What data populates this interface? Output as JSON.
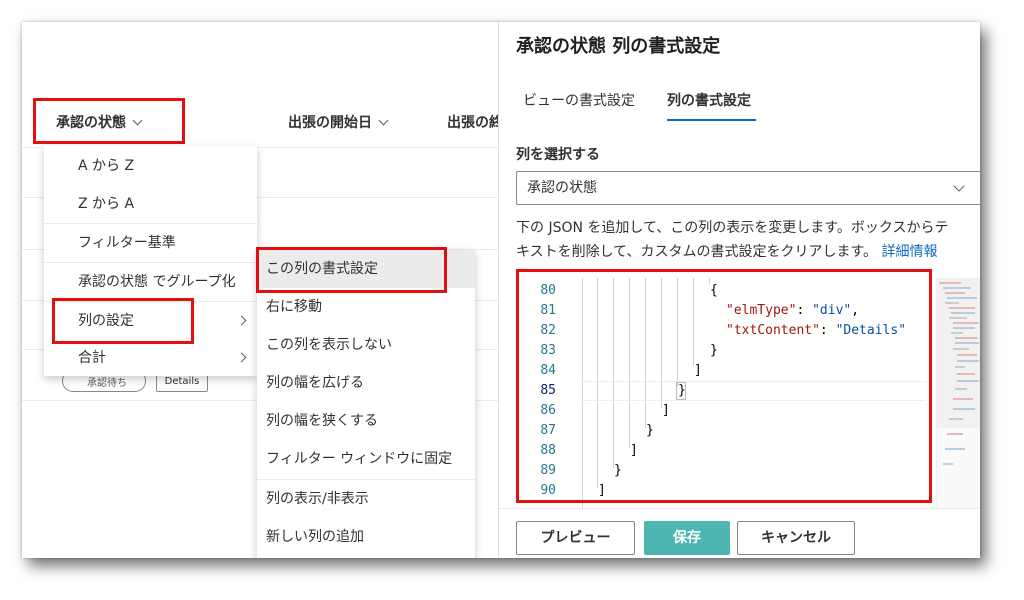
{
  "list": {
    "columns": [
      {
        "label": "承認の状態"
      },
      {
        "label": "出張の開始日"
      },
      {
        "label": "出張の終"
      }
    ],
    "row": {
      "status_label": "承認待ち",
      "details_label": "Details"
    }
  },
  "context_menu": {
    "items": [
      {
        "label": "A から Z"
      },
      {
        "label": "Z から A"
      },
      {
        "label": "フィルター基準"
      },
      {
        "label": "承認の状態 でグループ化"
      },
      {
        "label": "列の設定"
      },
      {
        "label": "合計"
      }
    ]
  },
  "submenu": {
    "items": [
      {
        "label": "この列の書式設定"
      },
      {
        "label": "右に移動"
      },
      {
        "label": "この列を表示しない"
      },
      {
        "label": "列の幅を広げる"
      },
      {
        "label": "列の幅を狭くする"
      },
      {
        "label": "フィルター ウィンドウに固定"
      },
      {
        "label": "列の表示/非表示"
      },
      {
        "label": "新しい列の追加"
      }
    ]
  },
  "panel": {
    "title": "承認の状態 列の書式設定",
    "tabs": [
      {
        "label": "ビューの書式設定"
      },
      {
        "label": "列の書式設定"
      }
    ],
    "select_label": "列を選択する",
    "selected_column": "承認の状態",
    "description_line1": "下の JSON を追加して、この列の表示を変更します。ボックスからテ",
    "description_line2": "キストを削除して、カスタムの書式設定をクリアします。",
    "learn_more": "詳細情報",
    "editor": {
      "line_numbers": [
        "80",
        "81",
        "82",
        "83",
        "84",
        "85",
        "86",
        "87",
        "88",
        "89",
        "90"
      ],
      "current_line": "85",
      "lines": [
        {
          "text": "{"
        },
        {
          "key": "\"elmType\"",
          "sep": ": ",
          "value": "\"div\"",
          "end": ","
        },
        {
          "key": "\"txtContent\"",
          "sep": ": ",
          "value": "\"Details\"",
          "end": ""
        },
        {
          "text": "}"
        },
        {
          "text": "]"
        },
        {
          "text": "}"
        },
        {
          "text": "]"
        },
        {
          "text": "}"
        },
        {
          "text": "]"
        },
        {
          "text": "}"
        },
        {
          "text": "]"
        }
      ]
    },
    "buttons": {
      "preview": "プレビュー",
      "save": "保存",
      "cancel": "キャンセル"
    }
  },
  "colors": {
    "highlight_box": "#e01010",
    "save_button": "#4db6b1",
    "link": "#0f6cbd",
    "tab_underline": "#0f6cbd",
    "json_key": "#a31515",
    "json_string": "#0451a5",
    "line_number": "#237893"
  }
}
